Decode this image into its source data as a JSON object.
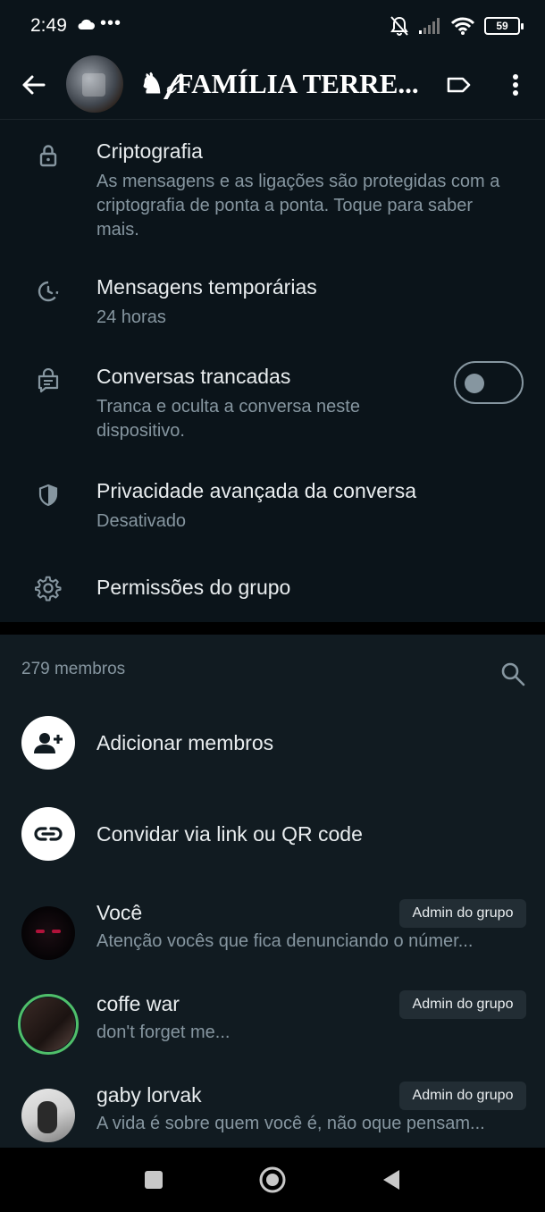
{
  "status_bar": {
    "time": "2:49",
    "battery": "59",
    "icons": [
      "cloud-icon",
      "more-dots-icon",
      "mute-bell-icon",
      "signal-icon",
      "wifi-icon",
      "battery-icon"
    ]
  },
  "header": {
    "group_name": "♞𝒻FAMÍLIA TERRE...",
    "icons": [
      "back-arrow-icon",
      "label-tag-icon",
      "more-vert-icon"
    ]
  },
  "settings": [
    {
      "id": "encryption",
      "icon": "lock-icon",
      "title": "Criptografia",
      "subtitle": "As mensagens e as ligações são protegidas com a criptografia de ponta a ponta. Toque para saber mais."
    },
    {
      "id": "disappearing",
      "icon": "timer-icon",
      "title": "Mensagens temporárias",
      "subtitle": "24 horas"
    },
    {
      "id": "locked",
      "icon": "chat-lock-icon",
      "title": "Conversas trancadas",
      "subtitle": "Tranca e oculta a conversa neste dispositivo.",
      "toggle_on": false
    },
    {
      "id": "privacy",
      "icon": "shield-icon",
      "title": "Privacidade avançada da conversa",
      "subtitle": "Desativado"
    },
    {
      "id": "permissions",
      "icon": "gear-icon",
      "title": "Permissões do grupo",
      "subtitle": ""
    }
  ],
  "members": {
    "count_label": "279 membros",
    "actions": [
      {
        "icon": "add-person-icon",
        "label": "Adicionar membros"
      },
      {
        "icon": "link-icon",
        "label": "Convidar via link ou QR code"
      }
    ],
    "list": [
      {
        "name": "Você",
        "status": "Atenção vocês que fica denunciando o númer...",
        "badge": "Admin do grupo"
      },
      {
        "name": "coffe war",
        "status": "don't forget me...",
        "badge": "Admin do grupo"
      },
      {
        "name": "gaby lorvak",
        "status": "A vida é sobre quem você é, não oque pensam...",
        "badge": "Admin do grupo"
      }
    ]
  },
  "colors": {
    "background": "#0b141a",
    "section_bg": "#111b21",
    "primary_text": "#e9edef",
    "secondary_text": "#8696a0",
    "status_ring": "#4fbf6a"
  }
}
